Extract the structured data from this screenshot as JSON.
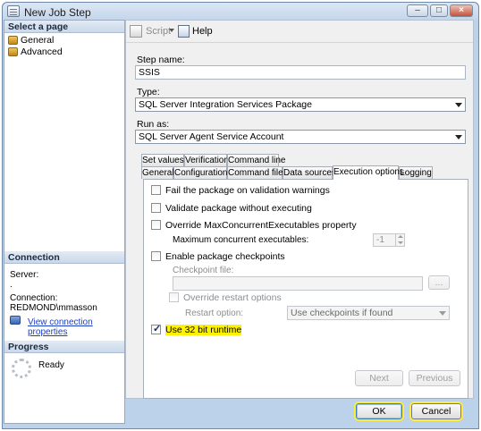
{
  "window": {
    "title": "New Job Step",
    "controls": [
      "–",
      "□",
      "×"
    ]
  },
  "left_pane": {
    "select_page_header": "Select a page",
    "pages": [
      {
        "label": "General",
        "icon": "page-gear-icon"
      },
      {
        "label": "Advanced",
        "icon": "page-gear-icon"
      }
    ],
    "connection": {
      "header": "Connection",
      "server_label": "Server:",
      "server_value": ".",
      "connection_label": "Connection:",
      "connection_value": "REDMOND\\mmasson",
      "view_properties": "View connection properties"
    },
    "progress": {
      "header": "Progress",
      "status": "Ready"
    }
  },
  "toolbar": {
    "script_label": "Script",
    "help_label": "Help"
  },
  "form": {
    "step_name_label": "Step name:",
    "step_name_value": "SSIS",
    "type_label": "Type:",
    "type_value": "SQL Server Integration Services Package",
    "run_as_label": "Run as:",
    "run_as_value": "SQL Server Agent Service Account"
  },
  "tabs": {
    "row1": [
      "Set values",
      "Verification",
      "Command line"
    ],
    "row2": [
      "General",
      "Configurations",
      "Command files",
      "Data sources",
      "Execution options",
      "Logging"
    ],
    "active": "Execution options"
  },
  "execution_options": {
    "fail_on_warnings": "Fail the package on validation warnings",
    "validate_without_executing": "Validate package without executing",
    "override_max_concurrent": "Override MaxConcurrentExecutables property",
    "max_concurrent_label": "Maximum concurrent executables:",
    "max_concurrent_value": "-1",
    "enable_checkpoints": "Enable package checkpoints",
    "checkpoint_file_label": "Checkpoint file:",
    "checkpoint_file_value": "",
    "browse_label": "...",
    "override_restart": "Override restart options",
    "restart_option_label": "Restart option:",
    "restart_option_value": "Use checkpoints if found",
    "use_32bit": "Use 32 bit runtime",
    "use_32bit_checked": true
  },
  "nav_buttons": {
    "next": "Next",
    "previous": "Previous"
  },
  "dialog_buttons": {
    "ok": "OK",
    "cancel": "Cancel"
  },
  "colors": {
    "highlight": "#fff200",
    "link": "#1a3ec4",
    "window_frame": "#bcd1ea"
  }
}
